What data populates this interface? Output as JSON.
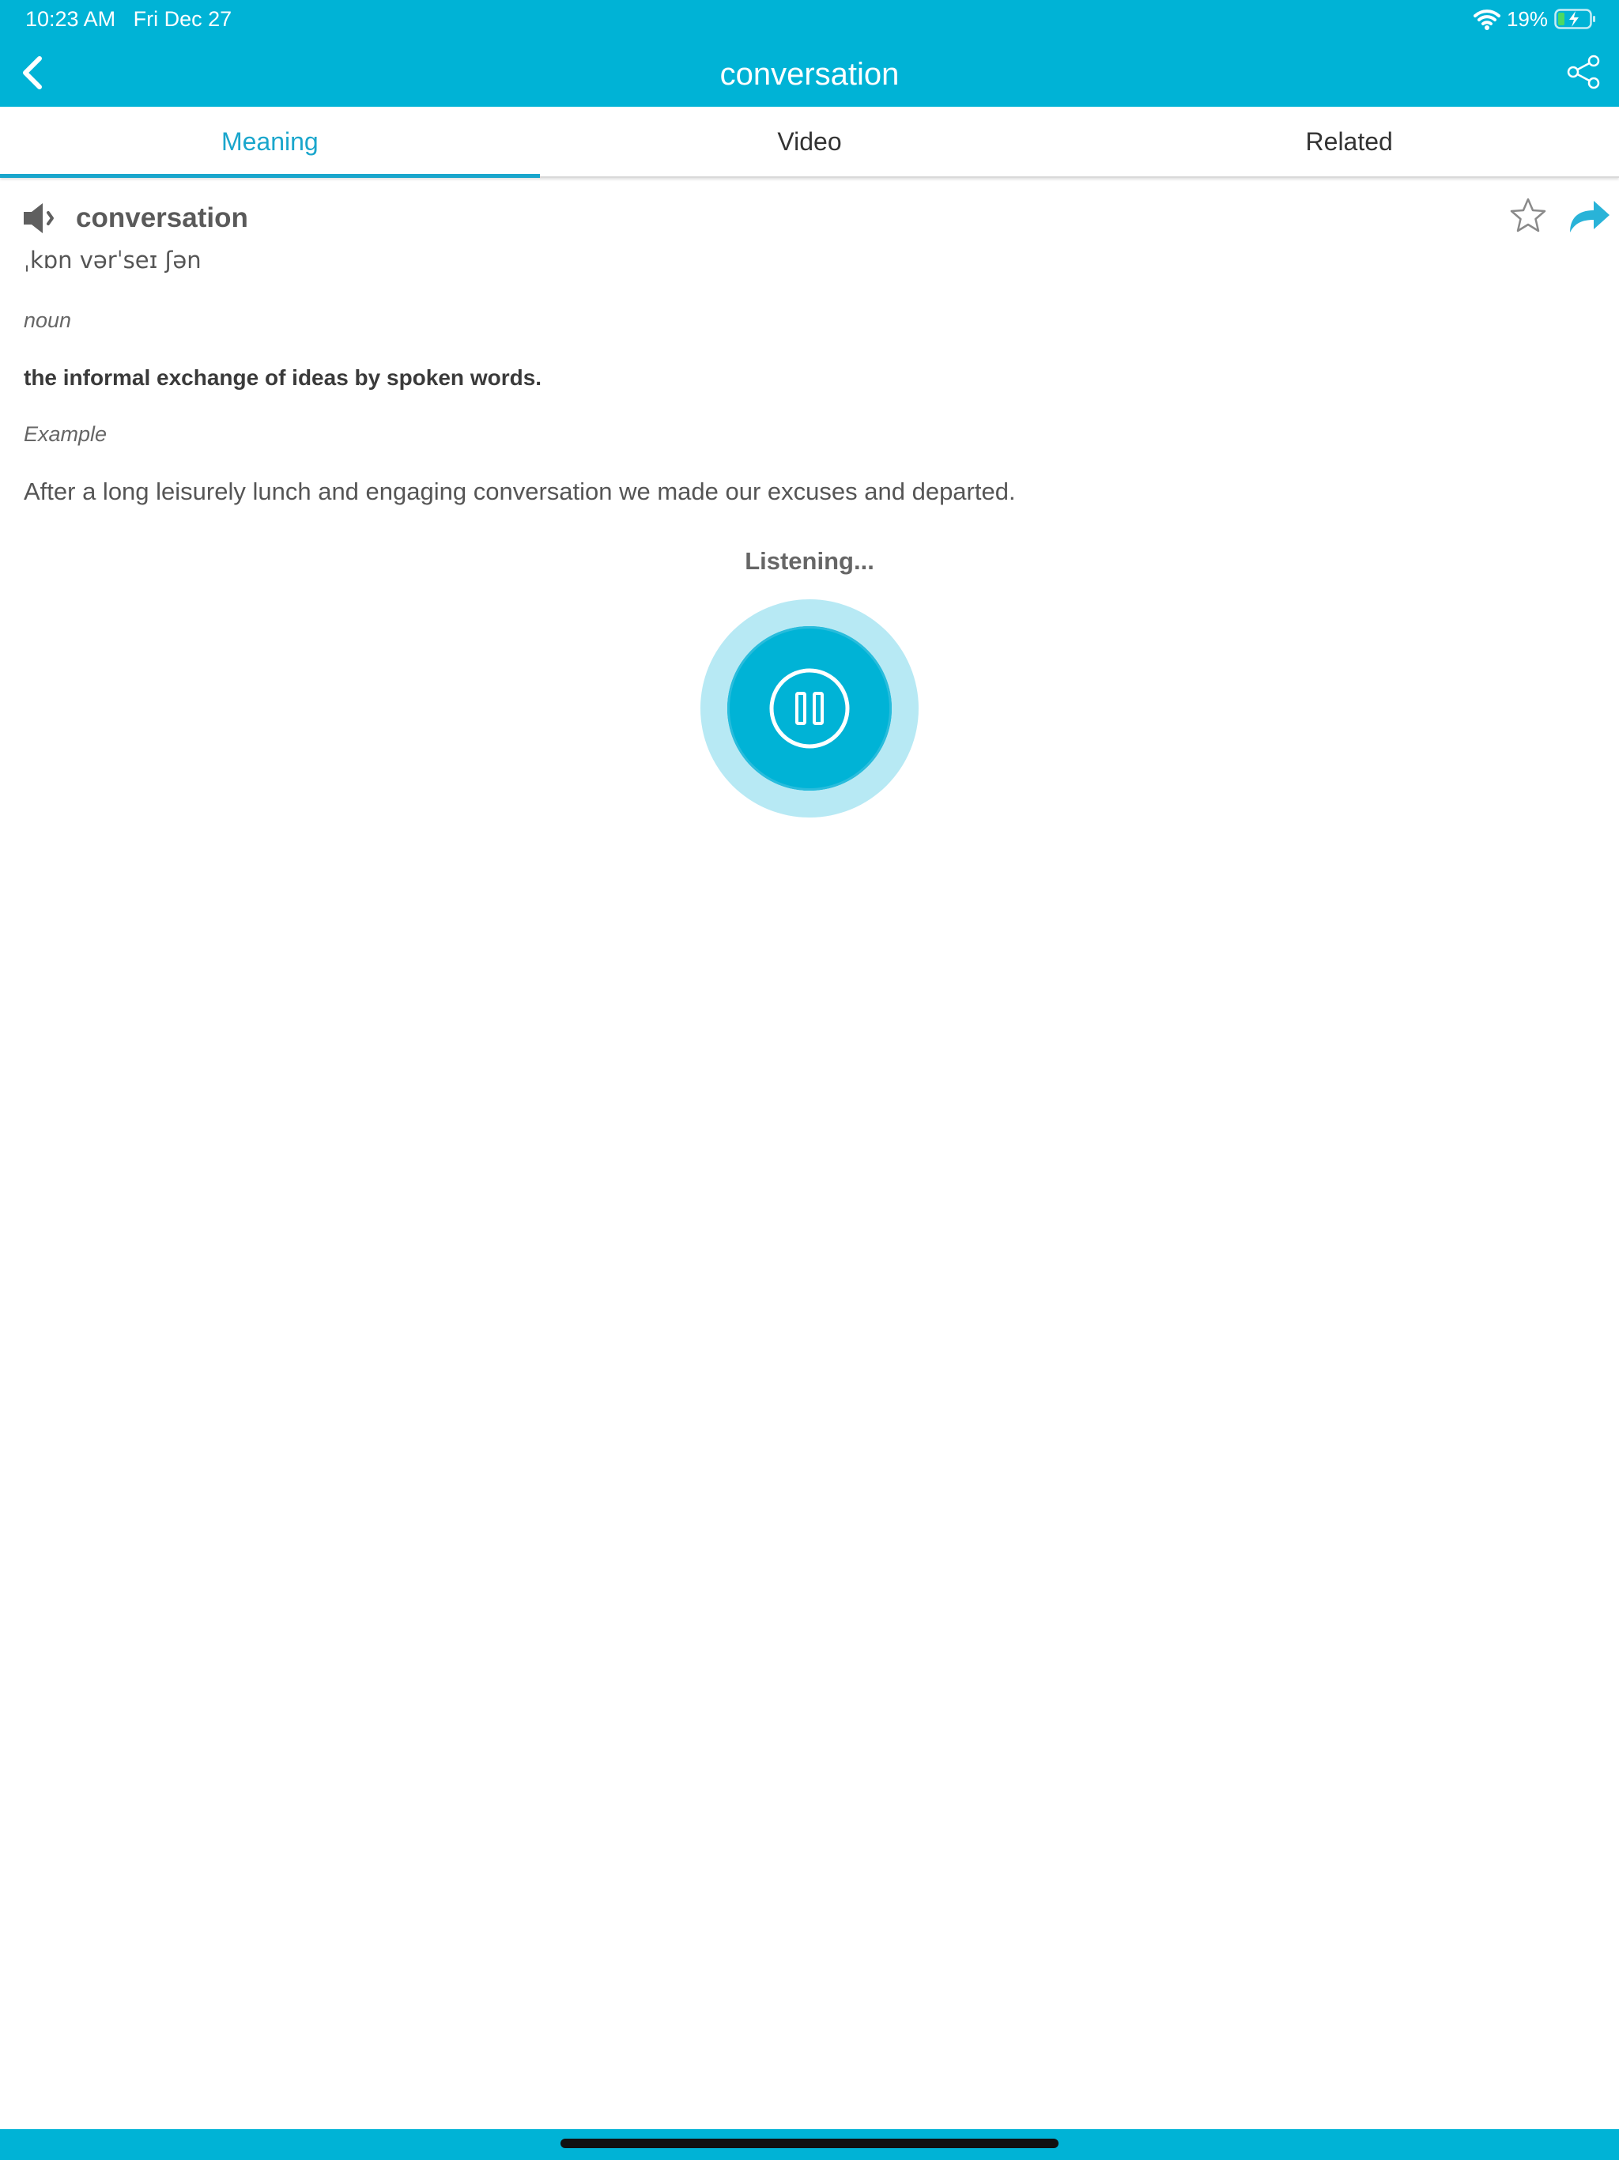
{
  "status_bar": {
    "time": "10:23 AM",
    "date": "Fri Dec 27",
    "battery": "19%",
    "icons": [
      "wifi-icon",
      "battery-charging-icon"
    ]
  },
  "header": {
    "title": "conversation",
    "back_icon": "chevron-left-icon",
    "share_icon": "share-nodes-icon"
  },
  "tabs": [
    {
      "label": "Meaning",
      "active": true
    },
    {
      "label": "Video",
      "active": false
    },
    {
      "label": "Related",
      "active": false
    }
  ],
  "entry": {
    "word": "conversation",
    "pronunciation": "ˌkɒn vərˈseɪ ʃən",
    "part_of_speech": "noun",
    "definition": "the informal exchange of ideas by spoken words.",
    "example_label": "Example",
    "example": "After a long leisurely lunch and engaging conversation we made our excuses and departed."
  },
  "listening": {
    "status": "Listening..."
  },
  "colors": {
    "brand": "#00b3d6",
    "tab_active": "#1aa6cc",
    "mic_halo": "#b7e9f4"
  }
}
